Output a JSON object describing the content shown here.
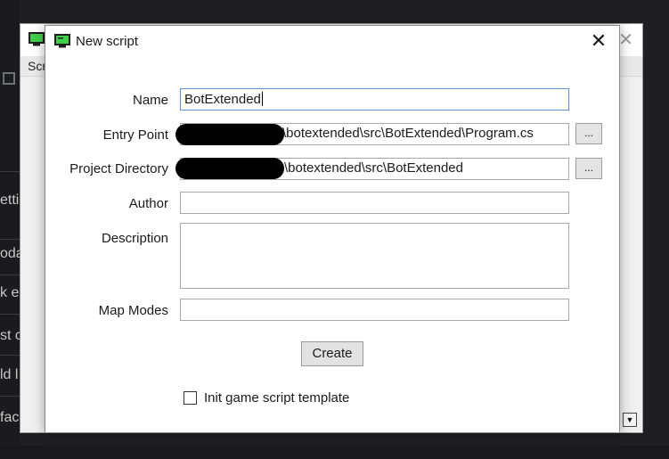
{
  "background": {
    "left_fragments": [
      "etti",
      "oda",
      "k ex",
      "st c",
      "ld l",
      "fac"
    ]
  },
  "parent_window": {
    "tab_label": "Scr",
    "close_glyph": "✕",
    "scroll_glyph": "▼"
  },
  "dialog": {
    "title": "New script",
    "close_glyph": "✕",
    "fields": {
      "name_label": "Name",
      "name_value": "BotExtended",
      "entry_point_label": "Entry Point",
      "entry_point_value": "\\botextended\\src\\BotExtended\\Program.cs",
      "project_dir_label": "Project Directory",
      "project_dir_value": "\\botextended\\src\\BotExtended",
      "author_label": "Author",
      "author_value": "",
      "description_label": "Description",
      "description_value": "",
      "map_modes_label": "Map Modes",
      "map_modes_value": ""
    },
    "browse_label": "...",
    "create_label": "Create",
    "init_template_label": "Init game script template",
    "init_template_checked": false
  },
  "colors": {
    "focus_border": "#5e95d8",
    "app_icon_green": "#3fd04a"
  }
}
